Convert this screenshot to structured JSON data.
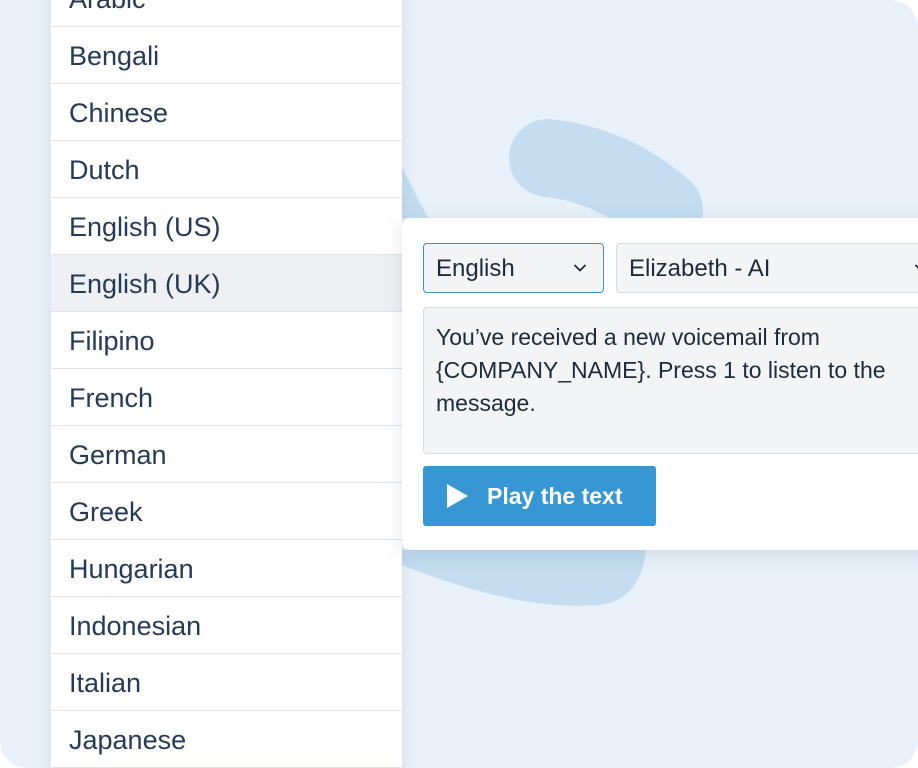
{
  "colors": {
    "background": "#e8f1f9",
    "decoration": "#c4ddf0",
    "accent": "#3797d4",
    "selected_row": "#eef0f3",
    "text": "#253a57"
  },
  "language_list": {
    "items": [
      {
        "label": "Arabic"
      },
      {
        "label": "Bengali"
      },
      {
        "label": "Chinese"
      },
      {
        "label": "Dutch"
      },
      {
        "label": "English (US)"
      },
      {
        "label": "English (UK)",
        "selected": true
      },
      {
        "label": "Filipino"
      },
      {
        "label": "French"
      },
      {
        "label": "German"
      },
      {
        "label": "Greek"
      },
      {
        "label": "Hungarian"
      },
      {
        "label": "Indonesian"
      },
      {
        "label": "Italian"
      },
      {
        "label": "Japanese"
      }
    ],
    "selected_label": "English (UK)"
  },
  "voice_card": {
    "language_select": {
      "value": "English",
      "icon": "chevron-down-icon"
    },
    "voice_select": {
      "value": "Elizabeth - AI",
      "icon": "chevron-down-icon"
    },
    "message_text": "You’ve received a new voicemail from\n{COMPANY_NAME}. Press 1 to listen to the\nmessage.",
    "play_button": {
      "label": "Play the text",
      "icon": "play-icon"
    }
  }
}
